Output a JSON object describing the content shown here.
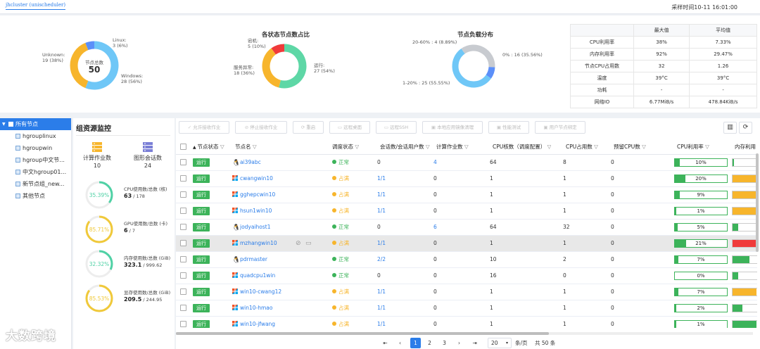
{
  "header": {
    "cluster_tab": "jhcluster (unischeduler)",
    "sample_time": "采样时间10-11 16:01:00"
  },
  "donut_os": {
    "center_label": "节点总数",
    "center_value": "50",
    "label_linux": "Linux:",
    "value_linux": "3 (6%)",
    "label_unknown": "Unknown:",
    "value_unknown": "19 (38%)",
    "label_windows": "Windows:",
    "value_windows": "28 (56%)",
    "colors": [
      "#6fc7f7",
      "#f7b52c",
      "#5b8ff9"
    ]
  },
  "donut_status": {
    "title": "各状态节点数占比",
    "label_down": "宕机:",
    "value_down": "5 (10%)",
    "label_busy": "服务异常:",
    "value_busy": "18 (36%)",
    "label_run": "运行:",
    "value_run": "27 (54%)",
    "colors": [
      "#5ed7a6",
      "#f7b52c",
      "#f03a3a"
    ]
  },
  "donut_load": {
    "title": "节点负载分布",
    "label_a": "20-60% : 4 (8.89%)",
    "label_b": "0% : 16 (35.56%)",
    "label_c": "1-20% : 25 (55.55%)",
    "colors": [
      "#6fc7f7",
      "#c8cbd0",
      "#5b8ff9"
    ]
  },
  "stats": {
    "head": [
      "",
      "最大值",
      "平均值"
    ],
    "rows": [
      [
        "CPU利用率",
        "38%",
        "7.33%"
      ],
      [
        "内存利用率",
        "92%",
        "29.47%"
      ],
      [
        "节点CPU占用数",
        "32",
        "1.26"
      ],
      [
        "温度",
        "39°C",
        "39°C"
      ],
      [
        "功耗",
        "-",
        "-"
      ],
      [
        "网络IO",
        "6.77MiB/s",
        "478.84KiB/s"
      ]
    ]
  },
  "tree": {
    "root": "所有节点",
    "items": [
      "hgrouplinux",
      "hgroupwin",
      "hgroup中文节...",
      "中文hgroup01...",
      "新节点组_new...",
      "其他节点"
    ]
  },
  "resmon": {
    "title": "组资源监控",
    "compute_label": "计算作业数",
    "compute_value": "10",
    "graphic_label": "图形会话数",
    "graphic_value": "24",
    "gauges": [
      {
        "pct": "35.39%",
        "frac": 0.3539,
        "color": "#4fd1a5",
        "label": "CPU使用数/总数 (核)",
        "used": "63",
        "total": " / 178"
      },
      {
        "pct": "85.71%",
        "frac": 0.8571,
        "color": "#f0c93a",
        "label": "GPU使用数/总数 (卡)",
        "used": "6",
        "total": " / 7"
      },
      {
        "pct": "32.32%",
        "frac": 0.3232,
        "color": "#4fd1a5",
        "label": "内存使用数/总数 (GiB)",
        "used": "323.1",
        "total": " / 999.62"
      },
      {
        "pct": "85.53%",
        "frac": 0.8553,
        "color": "#f0c93a",
        "label": "显存使用数/总数 (GiB)",
        "used": "209.5",
        "total": " / 244.95"
      }
    ]
  },
  "toolbar": {
    "buttons": [
      "允许接收作业",
      "停止接收作业",
      "重启",
      "远程桌面",
      "远程SSH",
      "本地应用镜像清理",
      "性能测试",
      "用户节点绑定"
    ]
  },
  "table": {
    "headers": [
      "节点状态",
      "节点名",
      "调度状态",
      "会话数/会话用户数",
      "计算作业数",
      "CPU核数（调度配置）",
      "CPU占用数",
      "预留CPU数",
      "CPU利用率",
      "内存利用"
    ],
    "rows": [
      {
        "status": "运行",
        "os": "linux",
        "name": "ai39abc",
        "sched": "正常",
        "sess": "0",
        "jobs": "4",
        "cores": "64",
        "used": "8",
        "reserved": "0",
        "cpu": "10%",
        "cpu_frac": 0.1,
        "mem_frac": 0.05,
        "mem_color": "#3cb35a"
      },
      {
        "status": "运行",
        "os": "win",
        "name": "cwangwin10",
        "sched": "占满",
        "sess": "1/1",
        "jobs": "0",
        "cores": "1",
        "used": "1",
        "reserved": "0",
        "cpu": "20%",
        "cpu_frac": 0.2,
        "mem_frac": 0.85,
        "mem_color": "#f7b52c"
      },
      {
        "status": "运行",
        "os": "win",
        "name": "gghepcwin10",
        "sched": "占满",
        "sess": "1/1",
        "jobs": "0",
        "cores": "1",
        "used": "1",
        "reserved": "0",
        "cpu": "9%",
        "cpu_frac": 0.09,
        "mem_frac": 0.85,
        "mem_color": "#f7b52c"
      },
      {
        "status": "运行",
        "os": "win",
        "name": "hsun1win10",
        "sched": "占满",
        "sess": "1/1",
        "jobs": "0",
        "cores": "1",
        "used": "1",
        "reserved": "0",
        "cpu": "1%",
        "cpu_frac": 0.01,
        "mem_frac": 0.85,
        "mem_color": "#f7b52c"
      },
      {
        "status": "运行",
        "os": "linux",
        "name": "jodyaihost1",
        "sched": "正常",
        "sess": "0",
        "jobs": "6",
        "cores": "64",
        "used": "32",
        "reserved": "0",
        "cpu": "5%",
        "cpu_frac": 0.05,
        "mem_frac": 0.2,
        "mem_color": "#3cb35a"
      },
      {
        "status": "运行",
        "os": "win",
        "name": "mzhangwin10",
        "sched": "占满",
        "sess": "1/1",
        "jobs": "0",
        "cores": "1",
        "used": "1",
        "reserved": "0",
        "cpu": "21%",
        "cpu_frac": 0.21,
        "mem_frac": 0.92,
        "mem_color": "#f03a3a",
        "selected": true
      },
      {
        "status": "运行",
        "os": "linux",
        "name": "pdrmaster",
        "sched": "正常",
        "sess": "2/2",
        "jobs": "0",
        "cores": "10",
        "used": "2",
        "reserved": "0",
        "cpu": "7%",
        "cpu_frac": 0.07,
        "mem_frac": 0.6,
        "mem_color": "#3cb35a"
      },
      {
        "status": "运行",
        "os": "win",
        "name": "quadcpu1win",
        "sched": "正常",
        "sess": "0",
        "jobs": "0",
        "cores": "16",
        "used": "0",
        "reserved": "0",
        "cpu": "0%",
        "cpu_frac": 0.0,
        "mem_frac": 0.2,
        "mem_color": "#3cb35a"
      },
      {
        "status": "运行",
        "os": "win",
        "name": "win10-cwang12",
        "sched": "占满",
        "sess": "1/1",
        "jobs": "0",
        "cores": "1",
        "used": "1",
        "reserved": "0",
        "cpu": "7%",
        "cpu_frac": 0.07,
        "mem_frac": 0.85,
        "mem_color": "#f7b52c"
      },
      {
        "status": "运行",
        "os": "win",
        "name": "win10-hmao",
        "sched": "占满",
        "sess": "1/1",
        "jobs": "0",
        "cores": "1",
        "used": "1",
        "reserved": "0",
        "cpu": "2%",
        "cpu_frac": 0.02,
        "mem_frac": 0.35,
        "mem_color": "#3cb35a"
      },
      {
        "status": "运行",
        "os": "win",
        "name": "win10-jfwang",
        "sched": "占满",
        "sess": "1/1",
        "jobs": "0",
        "cores": "1",
        "used": "1",
        "reserved": "0",
        "cpu": "1%",
        "cpu_frac": 0.01,
        "mem_frac": 0.85,
        "mem_color": "#3cb35a"
      }
    ]
  },
  "pager": {
    "pages": [
      "1",
      "2",
      "3"
    ],
    "page_size": "20",
    "per_page": "条/页",
    "total": "共 50 条"
  },
  "colors": {
    "accent": "#2b7de9",
    "ok": "#3cb35a",
    "warn": "#f7b52c"
  },
  "watermark": "大数跨境"
}
